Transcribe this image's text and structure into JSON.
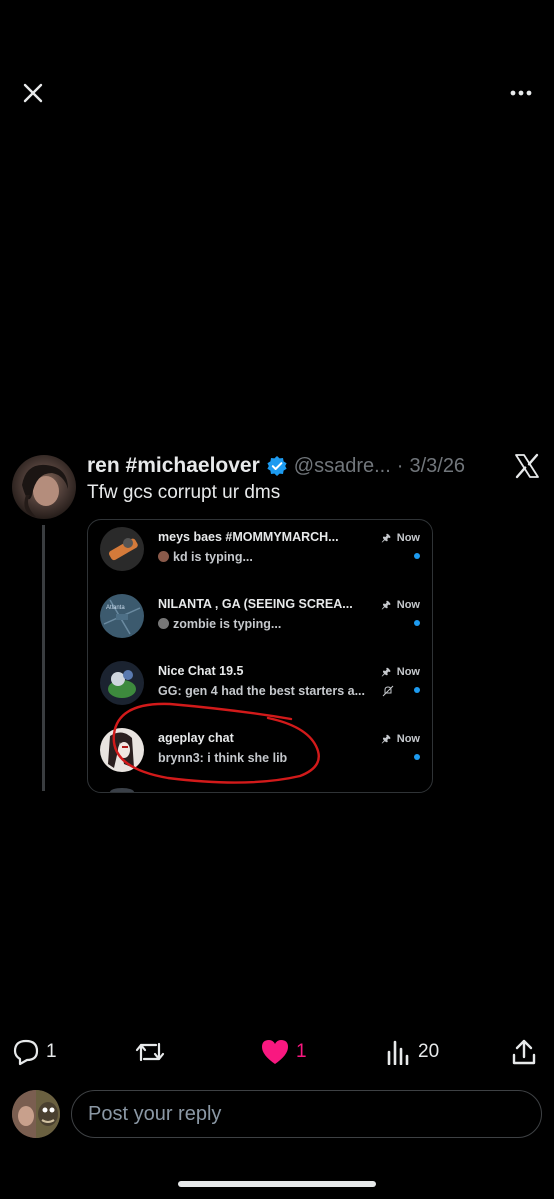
{
  "header": {
    "close_icon": "close-icon",
    "more_icon": "more-horizontal-icon"
  },
  "tweet": {
    "display_name": "ren #michaelover",
    "verified": true,
    "handle": "@ssadre...",
    "separator": "·",
    "date": "3/3/26",
    "text": "Tfw gcs corrupt ur dms",
    "brand_icon": "x-logo-icon"
  },
  "embedded_screenshot": {
    "chats": [
      {
        "title": "meys baes #MOMMYMARCH...",
        "subtitle": "kd is typing...",
        "time": "Now",
        "unread": true
      },
      {
        "title": "NILANTA , GA (SEEING SCREA...",
        "subtitle": "zombie is typing...",
        "time": "Now",
        "unread": true,
        "avatar_text": "Atlanta"
      },
      {
        "title": "Nice Chat 19.5",
        "subtitle": "GG: gen 4 had the best starters a...",
        "time": "Now",
        "unread": true,
        "muted": true
      },
      {
        "title": "ageplay chat",
        "subtitle": "brynn3: i think she lib",
        "time": "Now",
        "unread": true,
        "circled": true
      }
    ]
  },
  "actions": {
    "reply_count": "1",
    "retweet_count": "",
    "like_count": "1",
    "views_count": "20"
  },
  "reply": {
    "placeholder": "Post your reply"
  },
  "colors": {
    "background": "#000000",
    "verified_blue": "#1d9bf0",
    "like_pink": "#f91880",
    "annotation_red": "#d21a1a",
    "muted_text": "#71767b"
  }
}
